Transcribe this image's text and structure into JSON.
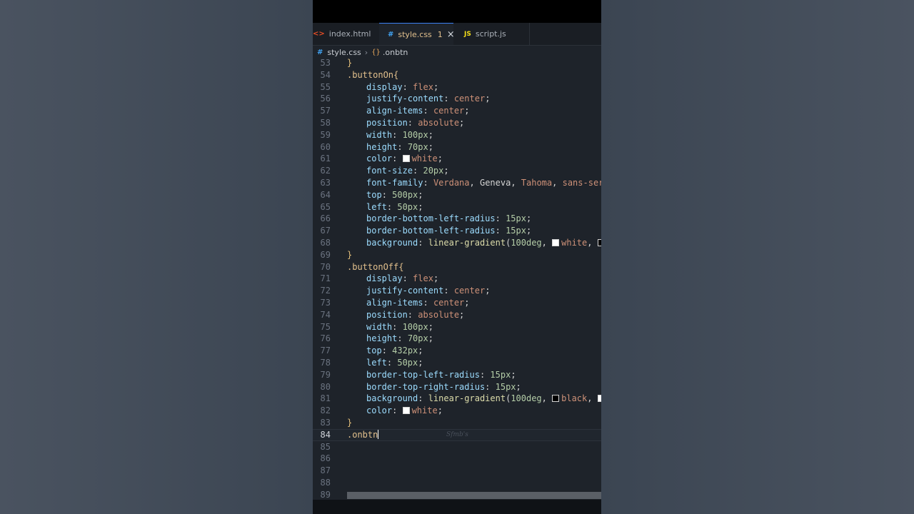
{
  "tabs": [
    {
      "label": "index.html",
      "icon": "html-file-icon",
      "active": false
    },
    {
      "label": "style.css",
      "icon": "css-file-icon",
      "active": true,
      "badge": "1"
    },
    {
      "label": "script.js",
      "icon": "js-file-icon",
      "active": false
    }
  ],
  "tab_icons": {
    "html": "<>",
    "css": "#",
    "js": "JS",
    "close": "×"
  },
  "breadcrumb": {
    "file": "style.css",
    "symbol": ".onbtn"
  },
  "ghost_text": "Sfmb's",
  "colors": {
    "accent": "#3b82f6",
    "editor_bg": "#1e232a",
    "property": "#9cdcfe",
    "keyword_value": "#ce9178",
    "number": "#b5cea8",
    "function": "#dcdcaa"
  },
  "code": {
    "l53": "}",
    "l54": ".buttonOn{",
    "l55": {
      "prop": "display",
      "val": "flex"
    },
    "l56": {
      "prop": "justify-content",
      "val": "center"
    },
    "l57": {
      "prop": "align-items",
      "val": "center"
    },
    "l58": {
      "prop": "position",
      "val": "absolute"
    },
    "l59": {
      "prop": "width",
      "val": "100px"
    },
    "l60": {
      "prop": "height",
      "val": "70px"
    },
    "l61": {
      "prop": "color",
      "val": "white"
    },
    "l62": {
      "prop": "font-size",
      "val": "20px"
    },
    "l63": {
      "prop": "font-family",
      "v1": "Verdana",
      "v2": "Geneva",
      "v3": "Tahoma",
      "v4": "sans-serif"
    },
    "l64": {
      "prop": "top",
      "val": "500px"
    },
    "l65": {
      "prop": "left",
      "val": "50px"
    },
    "l66": {
      "prop": "border-bottom-left-radius",
      "val": "15px"
    },
    "l67": {
      "prop": "border-bottom-left-radius",
      "val": "15px"
    },
    "l68": {
      "prop": "background",
      "fn": "linear-gradient",
      "arg": "100deg",
      "c1": "white",
      "c2": "bl"
    },
    "l69": "}",
    "l70": ".buttonOff{",
    "l71": {
      "prop": "display",
      "val": "flex"
    },
    "l72": {
      "prop": "justify-content",
      "val": "center"
    },
    "l73": {
      "prop": "align-items",
      "val": "center"
    },
    "l74": {
      "prop": "position",
      "val": "absolute"
    },
    "l75": {
      "prop": "width",
      "val": "100px"
    },
    "l76": {
      "prop": "height",
      "val": "70px"
    },
    "l77": {
      "prop": "top",
      "val": "432px"
    },
    "l78": {
      "prop": "left",
      "val": "50px"
    },
    "l79": {
      "prop": "border-top-left-radius",
      "val": "15px"
    },
    "l80": {
      "prop": "border-top-right-radius",
      "val": "15px"
    },
    "l81": {
      "prop": "background",
      "fn": "linear-gradient",
      "arg": "100deg",
      "c1": "black",
      "c2": "w"
    },
    "l82": {
      "prop": "color",
      "val": "white"
    },
    "l83": "}",
    "l84": ".onbtn"
  },
  "line_numbers": [
    "53",
    "54",
    "55",
    "56",
    "57",
    "58",
    "59",
    "60",
    "61",
    "62",
    "63",
    "64",
    "65",
    "66",
    "67",
    "68",
    "69",
    "70",
    "71",
    "72",
    "73",
    "74",
    "75",
    "76",
    "77",
    "78",
    "79",
    "80",
    "81",
    "82",
    "83",
    "84",
    "85",
    "86",
    "87",
    "88",
    "89"
  ]
}
